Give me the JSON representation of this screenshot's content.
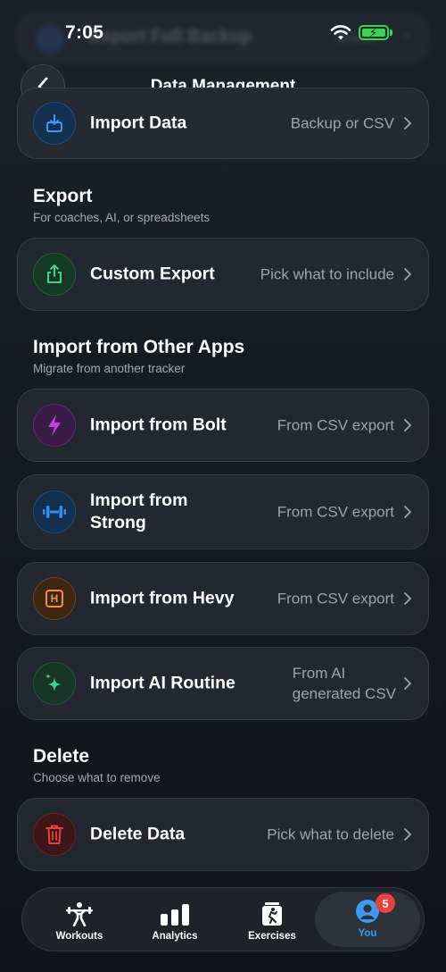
{
  "status_bar": {
    "time": "7:05"
  },
  "background_row": {
    "label": "Export Full Backup"
  },
  "header": {
    "title": "Data Management"
  },
  "import_data": {
    "label": "Import Data",
    "detail": "Backup or CSV"
  },
  "export_section": {
    "title": "Export",
    "subtitle": "For coaches, AI, or spreadsheets",
    "custom_export": {
      "label": "Custom Export",
      "detail": "Pick what to include"
    }
  },
  "import_apps_section": {
    "title": "Import from Other Apps",
    "subtitle": "Migrate from another tracker",
    "items": [
      {
        "label": "Import from Bolt",
        "detail": "From CSV export",
        "icon": "lightning-bolt-icon",
        "color": "#c23fe0"
      },
      {
        "label_line1": "Import from",
        "label_line2": "Strong",
        "detail": "From CSV export",
        "icon": "dumbbell-icon",
        "color": "#2f8ff0"
      },
      {
        "label": "Import from Hevy",
        "detail": "From CSV export",
        "icon": "h-letter-icon",
        "color": "#f0923a"
      },
      {
        "label": "Import AI Routine",
        "detail_line1": "From AI",
        "detail_line2": "generated CSV",
        "icon": "sparkles-icon",
        "color": "#3fd38a"
      }
    ]
  },
  "delete_section": {
    "title": "Delete",
    "subtitle": "Choose what to remove",
    "delete_data": {
      "label": "Delete Data",
      "detail": "Pick what to delete"
    }
  },
  "tab_bar": {
    "tabs": [
      {
        "label": "Workouts"
      },
      {
        "label": "Analytics"
      },
      {
        "label": "Exercises"
      },
      {
        "label": "You",
        "badge": "5"
      }
    ],
    "active_color": "#3a9bf5"
  }
}
